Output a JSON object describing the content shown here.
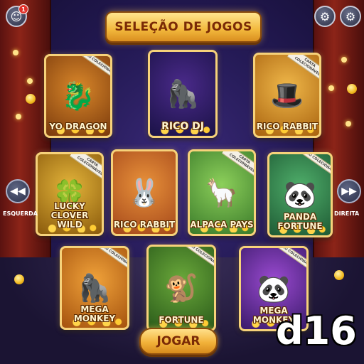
{
  "header": {
    "title": "SELEÇÃO DE JOGOS",
    "profile_icon": "profile-icon",
    "notification_count": "1",
    "settings_icons": [
      "gear-icon",
      "gear-icon"
    ]
  },
  "navigation": {
    "left_label": "ESQUERDA",
    "right_label": "DIREITA",
    "left_icon": "rewind-icon",
    "right_icon": "fast-forward-icon"
  },
  "cards": [
    {
      "title": "YO DRAGON",
      "badge": "JOGO COLECIONÁVEL",
      "art": "dragon",
      "colors": [
        "#d9872a",
        "#7a3a0c"
      ]
    },
    {
      "title": "RICO DJ",
      "badge": "",
      "art": "gorilla-dj",
      "colors": [
        "#4a2a8a",
        "#1a1246"
      ]
    },
    {
      "title": "RICO RABBIT",
      "badge": "CARTA COLECIONÁVEL",
      "art": "rabbit-gentleman",
      "colors": [
        "#f0b84a",
        "#a8620e"
      ]
    },
    {
      "title": "LUCKY CLOVER WILD",
      "badge": "CARTA COLECIONÁVEL",
      "art": "clover",
      "colors": [
        "#e3b43a",
        "#8a5a0c"
      ]
    },
    {
      "title": "RICO RABBIT",
      "badge": "",
      "art": "rabbit",
      "colors": [
        "#e8913a",
        "#a4471a"
      ]
    },
    {
      "title": "ALPACA PAYS",
      "badge": "CARTA COLECIONÁVEL",
      "art": "alpaca",
      "colors": [
        "#8ccf5a",
        "#3a7a2a"
      ]
    },
    {
      "title": "PANDA FORTUNE",
      "badge": "JOGO COLECIONÁVEL",
      "art": "panda",
      "colors": [
        "#4fae6a",
        "#1e5a34"
      ]
    },
    {
      "title": "MEGA MONKEY",
      "badge": "JOGO COLECIONÁVEL",
      "art": "monkey",
      "colors": [
        "#f0a23a",
        "#a4520e"
      ]
    },
    {
      "title": "FORTUNE",
      "badge": "JOGO COLECIONÁVEL",
      "art": "gorilla-jungle",
      "colors": [
        "#6aa83a",
        "#2a5a1a"
      ]
    },
    {
      "title": "MEGA MONKEY",
      "badge": "JOGO COLECIONÁVEL",
      "art": "panda-purple",
      "colors": [
        "#9a4ad0",
        "#3a1a6a"
      ]
    }
  ],
  "actions": {
    "play_label": "JOGAR"
  },
  "watermark": "d16"
}
